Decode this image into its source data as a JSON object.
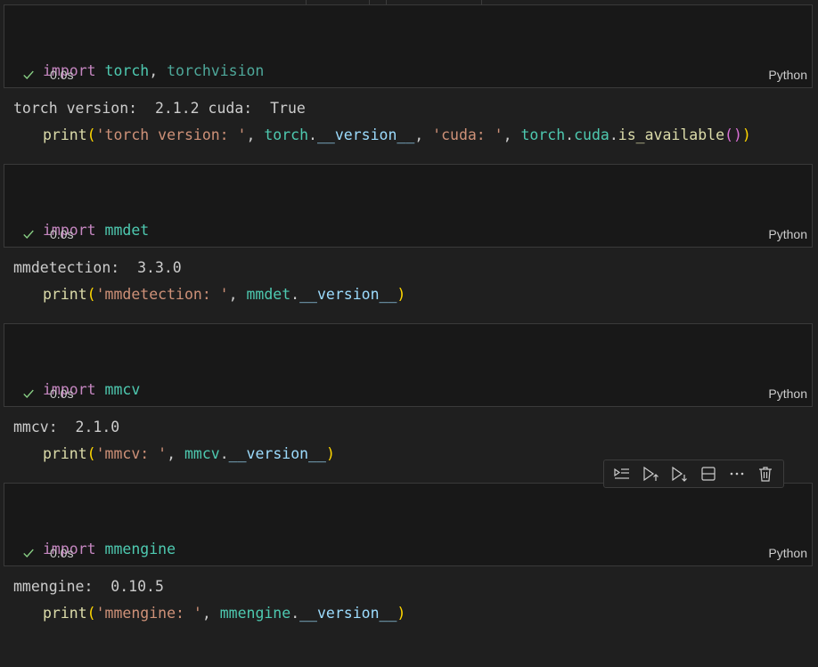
{
  "cells": [
    {
      "code_line1": {
        "kw": "import",
        "sp": " ",
        "m1": "torch",
        "comma": ", ",
        "m2": "torchvision"
      },
      "code_line2": {
        "fn": "print",
        "open": "(",
        "s1": "'torch version: '",
        "c1": ", ",
        "obj1": "torch",
        "dot1": ".",
        "a1": "__version__",
        "c2": ", ",
        "s2": "'cuda: '",
        "c3": ", ",
        "obj2": "torch",
        "dot2": ".",
        "a2": "cuda",
        "dot3": ".",
        "fn2": "is_available",
        "inner": "()",
        "close": ")"
      },
      "time": "0.0s",
      "language": "Python",
      "output": "torch version:  2.1.2 cuda:  True"
    },
    {
      "code_line1": {
        "kw": "import",
        "sp": " ",
        "m1": "mmdet"
      },
      "code_line2": {
        "fn": "print",
        "open": "(",
        "s1": "'mmdetection: '",
        "c1": ", ",
        "obj1": "mmdet",
        "dot1": ".",
        "a1": "__version__",
        "close": ")"
      },
      "time": "0.0s",
      "language": "Python",
      "output": "mmdetection:  3.3.0"
    },
    {
      "code_line1": {
        "kw": "import",
        "sp": " ",
        "m1": "mmcv"
      },
      "code_line2": {
        "fn": "print",
        "open": "(",
        "s1": "'mmcv: '",
        "c1": ", ",
        "obj1": "mmcv",
        "dot1": ".",
        "a1": "__version__",
        "close": ")"
      },
      "time": "0.0s",
      "language": "Python",
      "output": "mmcv:  2.1.0"
    },
    {
      "code_line1": {
        "kw": "import",
        "sp": " ",
        "m1": "mmengine"
      },
      "code_line2": {
        "fn": "print",
        "open": "(",
        "s1": "'mmengine: '",
        "c1": ", ",
        "obj1": "mmengine",
        "dot1": ".",
        "a1": "__version__",
        "close": ")"
      },
      "time": "0.0s",
      "language": "Python",
      "output": "mmengine:  0.10.5"
    }
  ],
  "toolbar": {
    "icons": [
      "execute-above-cells-icon",
      "run-above-icon",
      "run-below-icon",
      "split-cell-icon",
      "more-actions-icon",
      "delete-cell-icon"
    ],
    "more_label": "⋯"
  },
  "colors": {
    "keyword": "#c586c0",
    "function": "#dcdcaa",
    "string": "#ce9178",
    "module": "#4ec9b0",
    "attribute": "#9cdcfe",
    "bracket1": "#ffd700",
    "bracket2": "#da70d6",
    "success": "#89d185"
  }
}
